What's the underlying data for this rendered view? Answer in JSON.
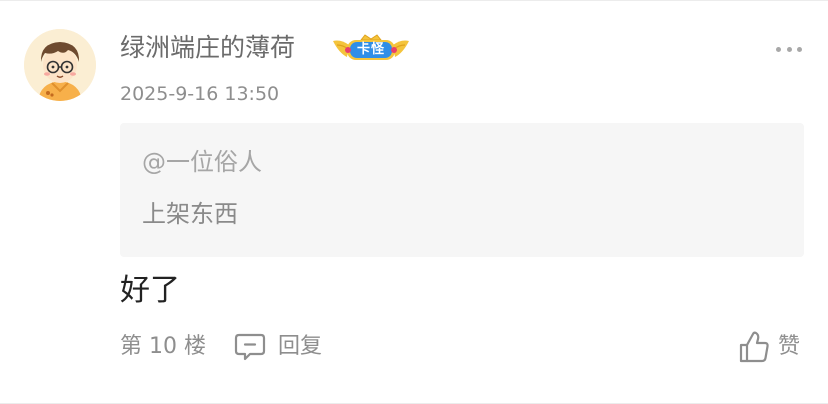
{
  "post": {
    "username": "绿洲端庄的薄荷",
    "badge_label": "卡怪",
    "timestamp": "2025-9-16 13:50",
    "quote": {
      "author": "@一位俗人",
      "text": "上架东西"
    },
    "content": "好了",
    "floor": "第 10 楼",
    "reply_label": "回复",
    "like_label": "赞"
  },
  "icons": {
    "avatar": "cartoon-boy-avatar",
    "badge": "gold-crown-badge",
    "more": "more-dots-icon",
    "reply": "comment-bubble-icon",
    "like": "thumbs-up-icon"
  },
  "colors": {
    "username": "#6b6b6b",
    "meta_text": "#8e8e8e",
    "quote_background": "#f6f6f6",
    "badge_blue": "#2f8ee8",
    "badge_gold": "#f4c43c"
  }
}
